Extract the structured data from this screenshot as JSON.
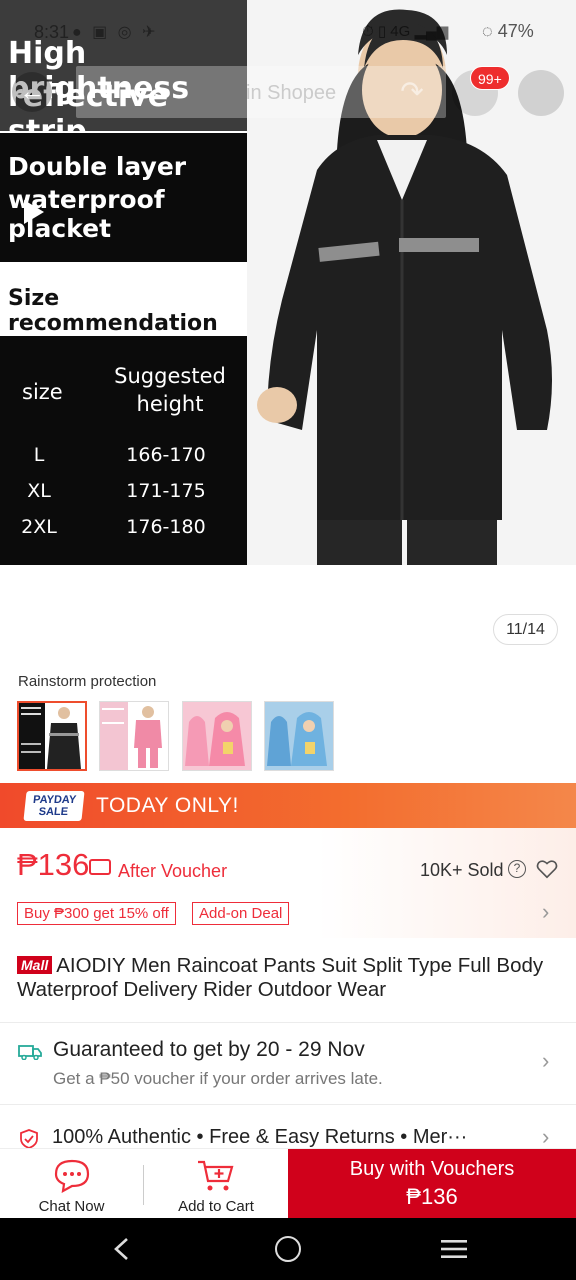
{
  "status_bar": {
    "time": "8:31",
    "battery": "47%",
    "network": "4G"
  },
  "nav": {
    "search_placeholder": "in Shopee",
    "cart_badge": "99+"
  },
  "image": {
    "overlay_line1": "High brightness",
    "overlay_line2": "reflective strip",
    "placket_line1": "Double layer",
    "placket_line2": "waterproof placket",
    "size_recommendation": "Size recommendation",
    "size_col": "size",
    "height_col_line1": "Suggested",
    "height_col_line2": "height",
    "sizes": [
      {
        "size": "L",
        "height": "166-170"
      },
      {
        "size": "XL",
        "height": "171-175"
      },
      {
        "size": "2XL",
        "height": "176-180"
      }
    ],
    "counter": "11/14"
  },
  "variations": {
    "title": "Rainstorm protection"
  },
  "promo": {
    "logo_line1": "PAYDAY",
    "logo_line2": "SALE",
    "text": "TODAY ONLY!"
  },
  "price": {
    "value": "₱136",
    "after_voucher": "After Voucher",
    "sold": "10K+ Sold",
    "tags": [
      "Buy ₱300 get 15% off",
      "Add-on Deal"
    ]
  },
  "product": {
    "badge": "Mall",
    "title": "AIODIY Men Raincoat Pants Suit Split Type Full Body Waterproof Delivery Rider Outdoor Wear"
  },
  "shipping": {
    "title": "Guaranteed to get by 20 - 29 Nov",
    "subtitle": "Get a ₱50 voucher if your order arrives late."
  },
  "assurance": {
    "text": "100% Authentic  •  Free & Easy Returns  •  Mer···"
  },
  "actions": {
    "chat": "Chat Now",
    "cart": "Add to Cart",
    "buy_line1": "Buy with Vouchers",
    "buy_line2": "₱136"
  },
  "colors": {
    "brand_red": "#d0011b",
    "price_red": "#ee2d3a",
    "promo_orange": "#f04a2b"
  }
}
